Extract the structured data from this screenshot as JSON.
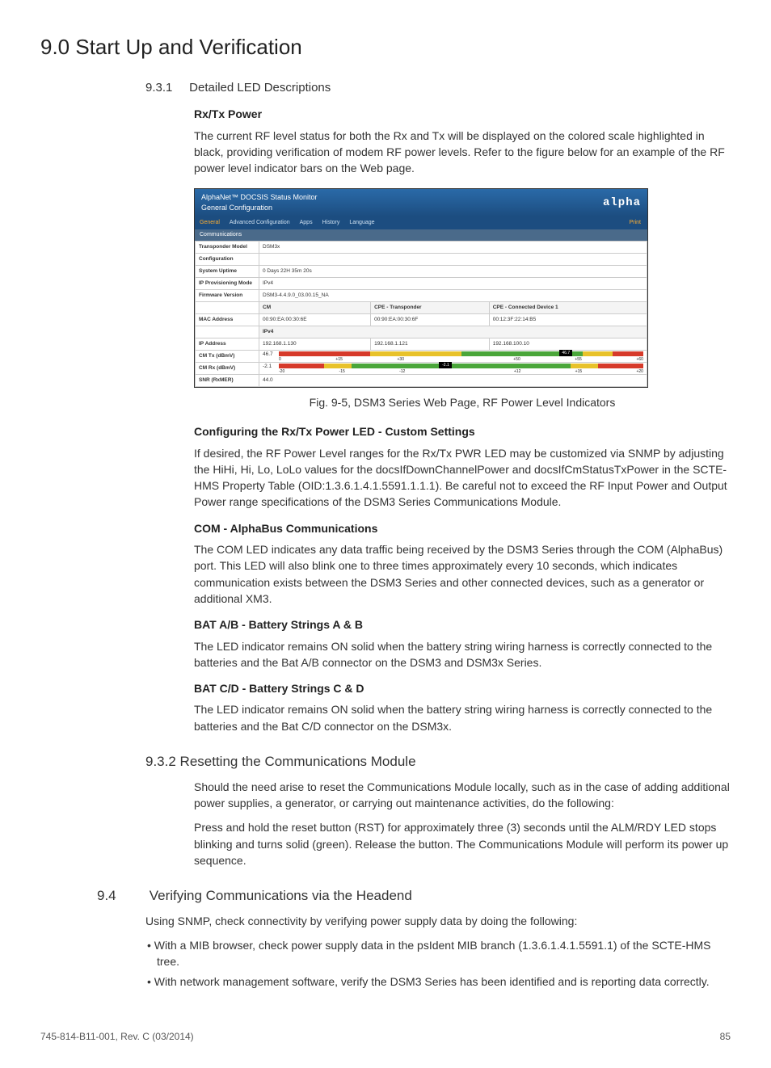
{
  "page_title": "9.0 Start Up and Verification",
  "sec_931": {
    "num": "9.3.1",
    "title": "Detailed LED Descriptions",
    "rx_tx": {
      "head": "Rx/Tx Power",
      "body": "The current RF level status for both the Rx and Tx will be displayed on the colored scale highlighted in black, providing verification of modem RF power levels. Refer to the figure below for an example of the RF power level indicator bars on the Web page."
    },
    "fig_caption": "Fig. 9-5, DSM3 Series Web Page, RF Power Level Indicators",
    "cfg_head": "Configuring the Rx/Tx Power LED - Custom Settings",
    "cfg_body": "If desired, the RF Power Level ranges for the Rx/Tx PWR LED may be customized via SNMP by adjusting the HiHi, Hi, Lo, LoLo values for the docsIfDownChannelPower and docsIfCmStatusTxPower in the SCTE-HMS Property Table (OID:1.3.6.1.4.1.5591.1.1.1). Be careful not to exceed the RF Input Power and Output Power range specifications of the DSM3 Series Communications Module.",
    "com_head": "COM - AlphaBus Communications",
    "com_body": "The COM LED indicates any data traffic being received by the DSM3 Series through the COM (AlphaBus) port. This LED will also blink one to three times approximately every 10 seconds, which indicates communication exists between the DSM3 Series and other connected devices, such as a generator or additional XM3.",
    "batab_head": "BAT A/B - Battery Strings A & B",
    "batab_body": "The LED indicator remains ON solid when the battery string wiring harness is correctly connected to the batteries and the Bat A/B connector on the DSM3 and DSM3x Series.",
    "batcd_head": "BAT C/D - Battery Strings C & D",
    "batcd_body": "The LED indicator remains ON solid when the battery string wiring harness is correctly connected to the batteries and the Bat C/D connector on the DSM3x."
  },
  "sec_932": {
    "num": "9.3.2",
    "title": "Resetting the Communications Module",
    "p1": "Should the need arise to reset the Communications Module locally, such as in the case of adding additional power supplies, a generator, or carrying out maintenance activities, do the following:",
    "p2": "Press and hold the reset button (RST) for approximately three (3) seconds until the ALM/RDY LED stops blinking and turns solid (green). Release the button. The Communications Module will perform its power up sequence."
  },
  "sec_94": {
    "num": "9.4",
    "title": "Verifying Communications via the Headend",
    "intro": "Using SNMP, check connectivity by verifying power supply data by doing the following:",
    "b1": "With a MIB browser, check power supply data in the psIdent MIB branch (1.3.6.1.4.1.5591.1) of the SCTE-HMS tree.",
    "b2": "With network management software, verify the DSM3 Series has been identified and is reporting data correctly."
  },
  "footer": {
    "left": "745-814-B11-001, Rev. C (03/2014)",
    "right": "85"
  },
  "screenshot": {
    "title_line1": "AlphaNet™ DOCSIS Status Monitor",
    "title_line2": "General Configuration",
    "logo": "alpha",
    "tabs": [
      "General",
      "Advanced Configuration",
      "Apps",
      "History",
      "Language"
    ],
    "print": "Print",
    "section": "Communications",
    "rows": {
      "model_label": "Transponder Model",
      "model_val": "DSM3x",
      "config_label": "Configuration",
      "config_val": "",
      "uptime_label": "System Uptime",
      "uptime_val": "0 Days 22H 35m 20s",
      "prov_label": "IP Provisioning Mode",
      "prov_val": "IPv4",
      "fw_label": "Firmware Version",
      "fw_val": "DSM3-4.4.9.0_03.00.15_NA",
      "col_cm": "CM",
      "col_cpe_t": "CPE - Transponder",
      "col_cpe_d": "CPE - Connected Device 1",
      "mac_label": "MAC Address",
      "mac_cm": "00:90:EA:00:30:6E",
      "mac_t": "00:90:EA:00:30:6F",
      "mac_d": "00:12:3F:22:14:B5",
      "ipv4": "IPv4",
      "ip_label": "IP Address",
      "ip_cm": "192.168.1.130",
      "ip_t": "192.168.1.121",
      "ip_d": "192.168.100.10",
      "tx_label": "CM Tx (dBmV)",
      "tx_val": "46.7",
      "tx_ticks": [
        "0",
        "+15",
        "+30",
        "",
        "+50",
        "+55",
        "+60"
      ],
      "tx_marker": "46.7",
      "rx_label": "CM Rx (dBmV)",
      "rx_val": "-2.1",
      "rx_ticks": [
        "-20",
        "-15",
        "-12",
        "",
        "+12",
        "+15",
        "+20"
      ],
      "rx_marker": "-2.1",
      "snr_label": "SNR (RxMER)",
      "snr_val": "44.0"
    }
  }
}
